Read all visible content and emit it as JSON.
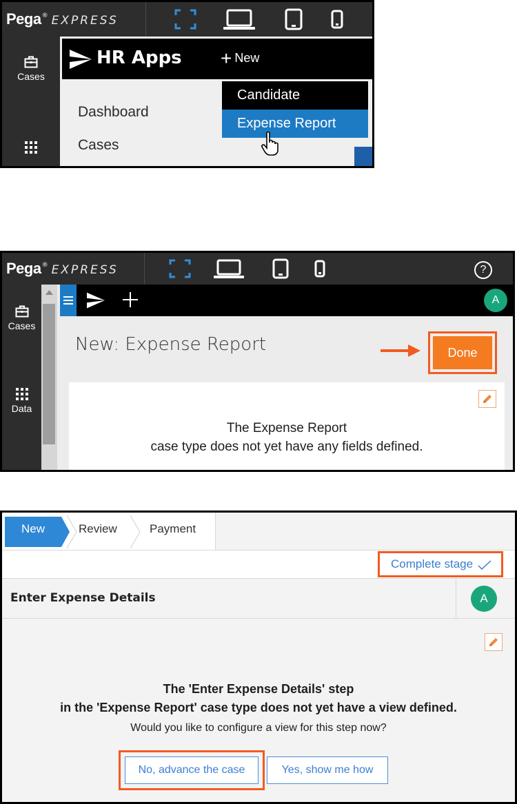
{
  "brand": {
    "pega": "Pega",
    "registered": "®",
    "express": "EXPRESS"
  },
  "icons": [
    "fullscreen-icon",
    "laptop-icon",
    "tablet-icon",
    "phone-icon",
    "briefcase-icon",
    "grid-icon",
    "help-icon",
    "pencil-icon",
    "arrow-right-icon",
    "checkmark-icon",
    "pointer-hand-icon",
    "hamburger-icon",
    "plus-icon"
  ],
  "colors": {
    "accent_blue": "#1d7bc4",
    "orange": "#f47b20",
    "highlight_border": "#f25b1f",
    "avatar_green": "#1aa67c",
    "dark_bar": "#2d2d2d"
  },
  "panel1": {
    "rail": {
      "cases_label": "Cases"
    },
    "app_title": "HR Apps",
    "new_label": "New",
    "nav": {
      "dashboard": "Dashboard",
      "cases": "Cases"
    },
    "menu": {
      "candidate": "Candidate",
      "expense_report": "Expense Report"
    }
  },
  "panel2": {
    "help_glyph": "?",
    "rail": {
      "cases_label": "Cases",
      "data_label": "Data"
    },
    "avatar_initial": "A",
    "page_title": "New:  Expense Report",
    "done_label": "Done",
    "message_line1": "The  Expense Report",
    "message_line2": "case type does not yet have any fields defined."
  },
  "panel3": {
    "stages": [
      "New",
      "Review",
      "Payment"
    ],
    "complete_stage_label": "Complete stage",
    "header_title": "Enter Expense Details",
    "avatar_initial": "A",
    "message_line1": "The 'Enter Expense Details' step",
    "message_line2": "in the 'Expense Report' case type does not yet have a view defined.",
    "question": "Would you like to configure a view for this step now?",
    "advance_label": "No, advance the case",
    "show_label": "Yes, show me how"
  }
}
